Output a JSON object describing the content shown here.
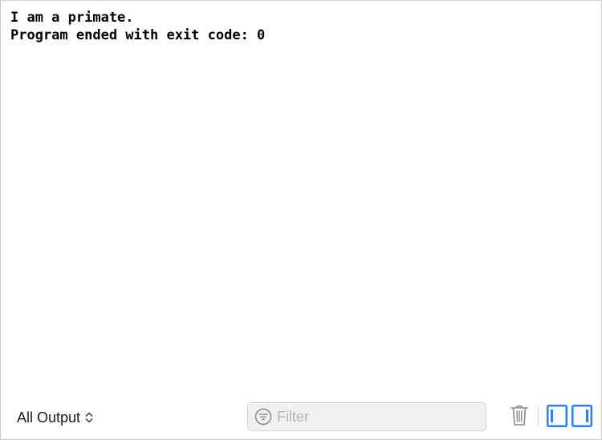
{
  "console": {
    "output_lines": [
      "I am a primate.",
      "Program ended with exit code: 0"
    ]
  },
  "bottom_bar": {
    "output_selector_label": "All Output",
    "filter_placeholder": "Filter",
    "filter_value": ""
  },
  "icons": {
    "selector": "updown-chevron-icon",
    "filter": "filter-icon",
    "trash": "trash-icon",
    "left_pane": "left-pane-toggle-icon",
    "right_pane": "right-pane-toggle-icon"
  },
  "colors": {
    "accent_blue": "#2d7ff9",
    "icon_gray": "#8a8a8a",
    "text": "#000000"
  }
}
